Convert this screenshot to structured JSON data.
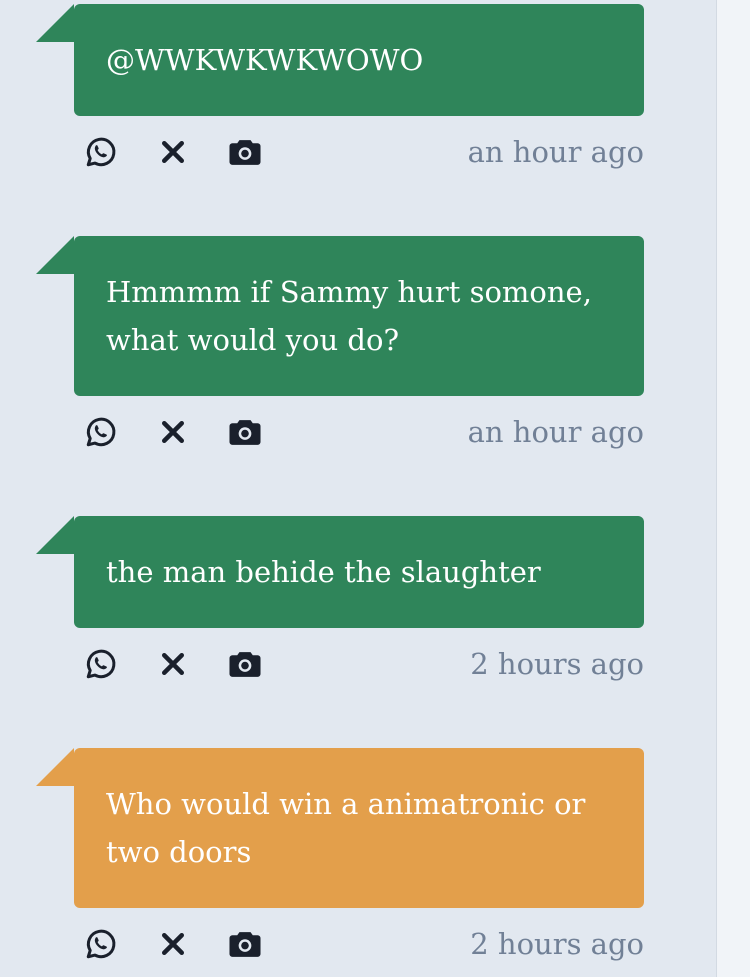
{
  "colors": {
    "green_bubble": "#2f855a",
    "orange_bubble": "#e39f4b",
    "background": "#e2e8f0",
    "timestamp": "#718096",
    "icon": "#1a202c"
  },
  "messages": [
    {
      "lines": [
        "@WWKWKWKWOWO"
      ],
      "time": "an hour ago",
      "color": "green",
      "icons": [
        "whatsapp-icon",
        "x-icon",
        "camera-icon"
      ]
    },
    {
      "lines": [
        "Hmmmm if Sammy hurt somone,",
        "what would you do?"
      ],
      "time": "an hour ago",
      "color": "green",
      "icons": [
        "whatsapp-icon",
        "x-icon",
        "camera-icon"
      ]
    },
    {
      "lines": [
        "the man behide the slaughter"
      ],
      "time": "2 hours ago",
      "color": "green",
      "icons": [
        "whatsapp-icon",
        "x-icon",
        "camera-icon"
      ]
    },
    {
      "lines": [
        "Who would win a animatronic or",
        "two doors"
      ],
      "time": "2 hours ago",
      "color": "orange",
      "icons": [
        "whatsapp-icon",
        "x-icon",
        "camera-icon"
      ]
    }
  ]
}
